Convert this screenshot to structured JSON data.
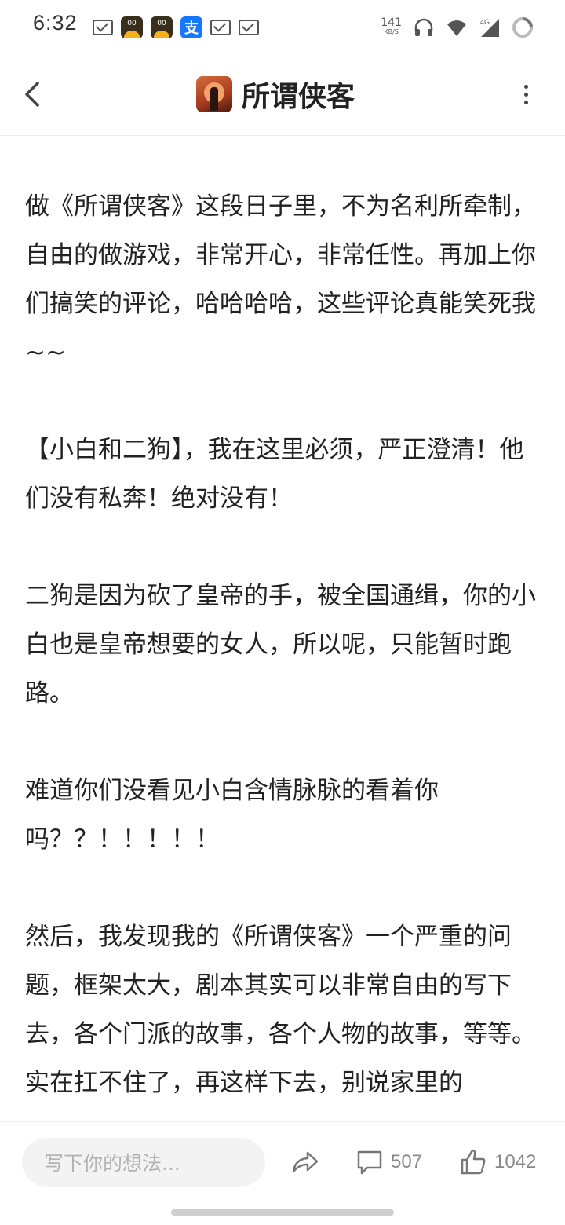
{
  "status_bar": {
    "time": "6:32",
    "app_badge_label": "00",
    "alipay_label": "支",
    "net_speed_value": "141",
    "net_speed_unit": "KB/S",
    "network_type": "4G"
  },
  "header": {
    "title": "所谓侠客"
  },
  "article": {
    "paragraphs": [
      "做《所谓侠客》这段日子里，不为名利所牵制，自由的做游戏，非常开心，非常任性。再加上你们搞笑的评论，哈哈哈哈，这些评论真能笑死我~~",
      "【小白和二狗】，我在这里必须，严正澄清！他们没有私奔！绝对没有！",
      "二狗是因为砍了皇帝的手，被全国通缉，你的小白也是皇帝想要的女人，所以呢，只能暂时跑路。",
      "难道你们没看见小白含情脉脉的看着你吗？？！！！！！",
      "然后，我发现我的《所谓侠客》一个严重的问题，框架太大，剧本其实可以非常自由的写下去，各个门派的故事，各个人物的故事，等等。实在扛不住了，再这样下去，别说家里的"
    ]
  },
  "bottom_bar": {
    "comment_placeholder": "写下你的想法...",
    "comment_count": "507",
    "like_count": "1042"
  }
}
